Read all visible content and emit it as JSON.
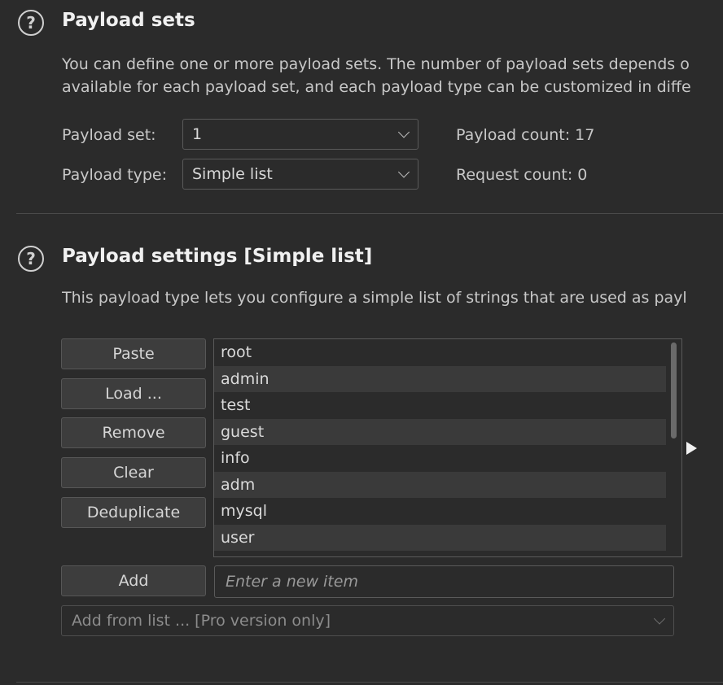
{
  "payload_sets": {
    "help_glyph": "?",
    "title": "Payload sets",
    "description_line1": "You can define one or more payload sets. The number of payload sets depends o",
    "description_line2": "available for each payload set, and each payload type can be customized in diffe",
    "set_label": "Payload set:",
    "set_value": "1",
    "type_label": "Payload type:",
    "type_value": "Simple list",
    "payload_count": "Payload count: 17",
    "request_count": "Request count: 0"
  },
  "payload_settings": {
    "help_glyph": "?",
    "title": "Payload settings [Simple list]",
    "description": "This payload type lets you configure a simple list of strings that are used as payl",
    "buttons": {
      "paste": "Paste",
      "load": "Load ...",
      "remove": "Remove",
      "clear": "Clear",
      "deduplicate": "Deduplicate",
      "add": "Add"
    },
    "items": [
      "root",
      "admin",
      "test",
      "guest",
      "info",
      "adm",
      "mysql",
      "user"
    ],
    "new_item_placeholder": "Enter a new item",
    "add_from_list": "Add from list ... [Pro version only]"
  },
  "icons": {
    "help": "help-circle-icon",
    "dropdown": "chevron-down-icon",
    "expand": "triangle-right-icon"
  },
  "colors": {
    "background": "#2b2b2b",
    "button": "#3d3d3d",
    "row_alt": "#3a3a3a"
  }
}
